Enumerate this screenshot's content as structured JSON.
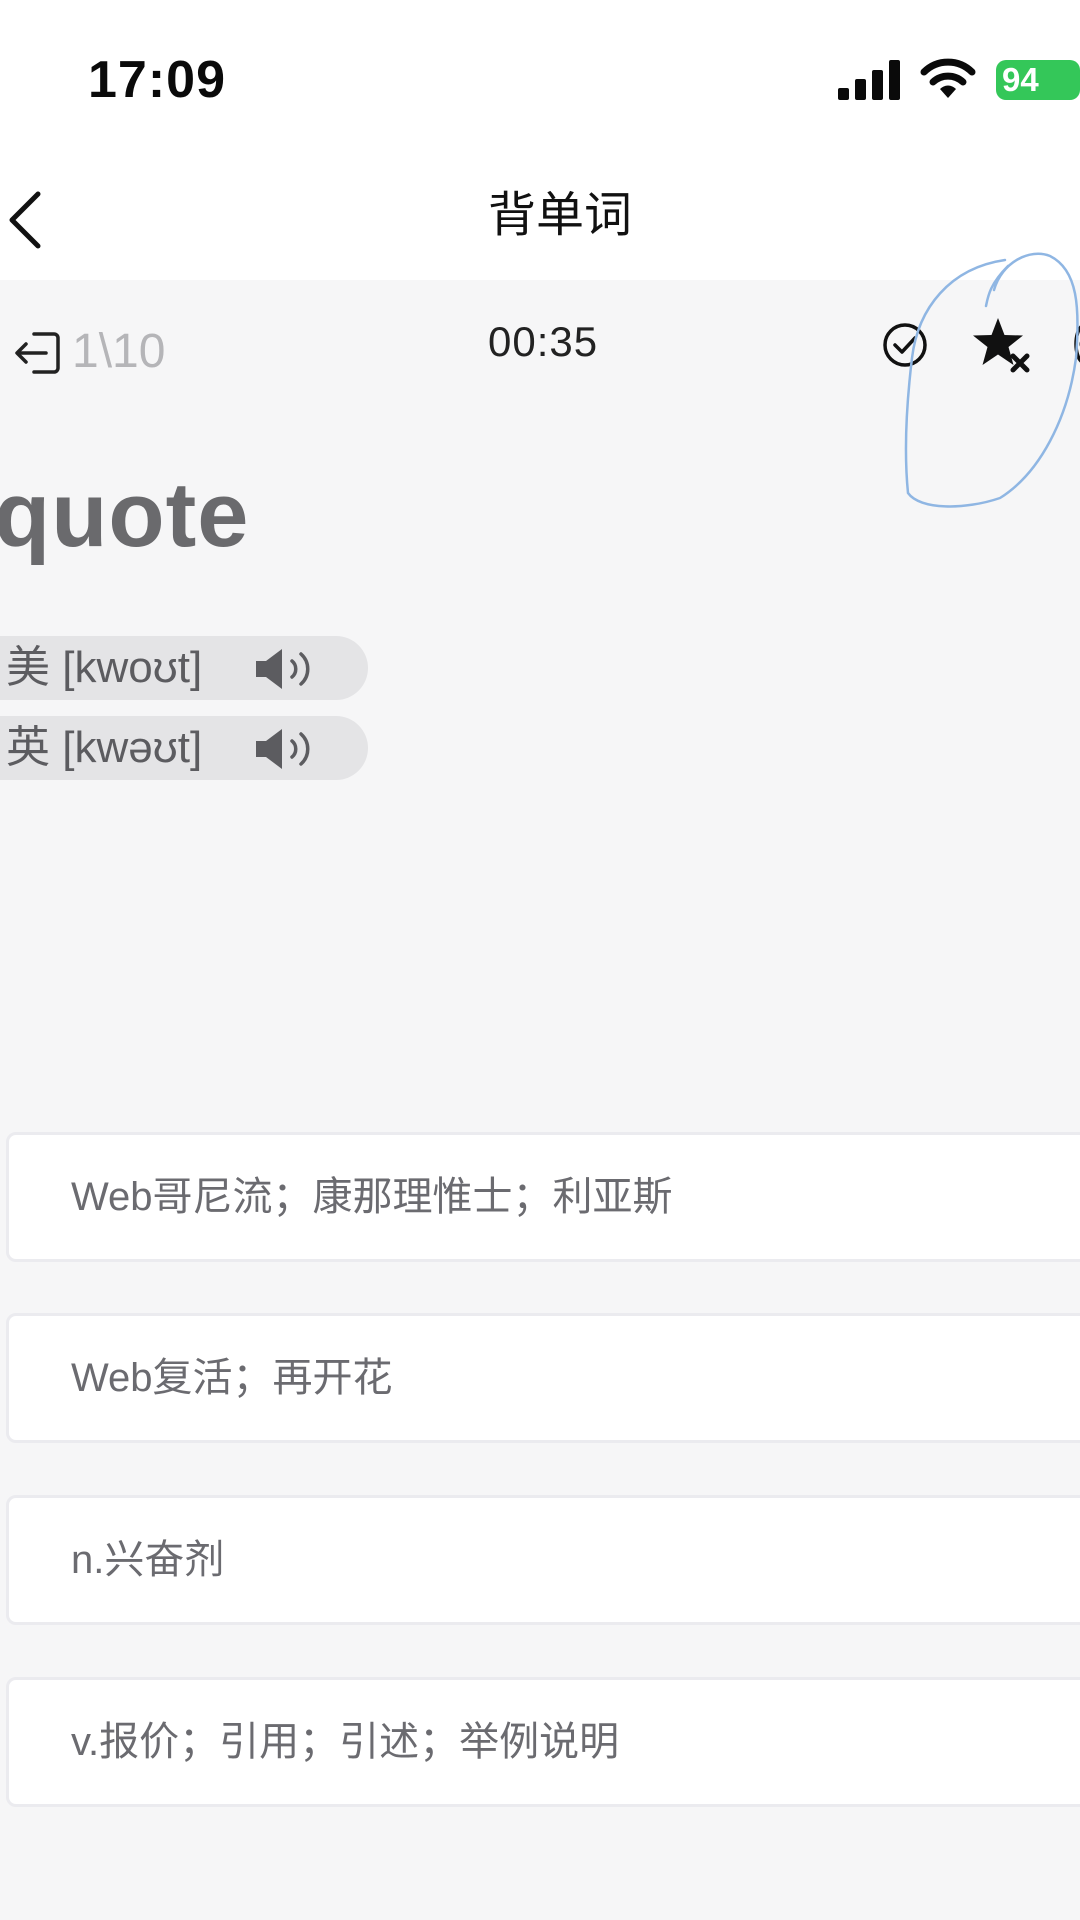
{
  "status_bar": {
    "time": "17:09",
    "battery": "94",
    "signal_icon": "cellular-signal-icon",
    "wifi_icon": "wifi-icon"
  },
  "nav": {
    "title": "背单词",
    "back_icon": "chevron-left-icon"
  },
  "toolbar": {
    "progress": "1\\10",
    "timer": "00:35",
    "exit_icon": "exit-icon",
    "check_icon": "check-circle-icon",
    "star_icon": "star-remove-icon"
  },
  "word": {
    "text": "quote",
    "phonetics": [
      {
        "region": "美",
        "ipa": "[kwoʊt]"
      },
      {
        "region": "英",
        "ipa": "[kwəʊt]"
      }
    ]
  },
  "options": [
    {
      "text": "Web哥尼流；康那理惟士；利亚斯"
    },
    {
      "text": "Web复活；再开花"
    },
    {
      "text": "n.兴奋剂"
    },
    {
      "text": "v.报价；引用；引述；举例说明"
    }
  ],
  "colors": {
    "battery": "#34c759",
    "background": "#f6f6f7",
    "pen_mark": "#8fb6e3"
  }
}
